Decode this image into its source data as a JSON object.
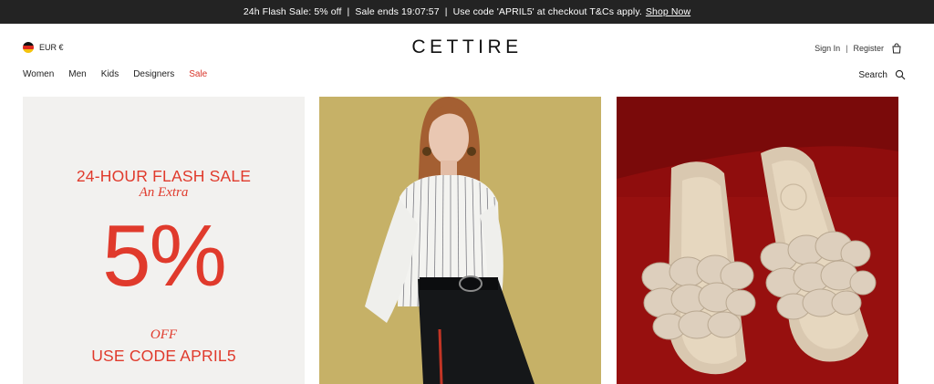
{
  "promo": {
    "text": "24h Flash Sale: 5% off  |  Sale ends 19:07:57  |  Use code 'APRIL5' at checkout T&Cs apply.",
    "link": "Shop Now"
  },
  "header": {
    "currency": "EUR €",
    "flag_colors": [
      "#111111",
      "#dd2a1f",
      "#f4c20d"
    ],
    "logo": "CETTIRE",
    "sign_in": "Sign In",
    "separator": "|",
    "register": "Register",
    "search_label": "Search"
  },
  "nav": {
    "items": [
      {
        "label": "Women"
      },
      {
        "label": "Men"
      },
      {
        "label": "Kids"
      },
      {
        "label": "Designers"
      },
      {
        "label": "Sale",
        "accent": "#d8352a"
      }
    ]
  },
  "tiles": {
    "flash": {
      "title": "24-HOUR FLASH SALE",
      "subtitle": "An Extra",
      "percent": "5%",
      "off": "OFF",
      "code": "USE CODE APRIL5",
      "accent_color": "#e03a2c",
      "background": "#f2f1ef"
    },
    "women": {
      "image": "model-photo",
      "background": "#c9b66e"
    },
    "shoes": {
      "image": "sandals-photo",
      "background": "#8f0d0d"
    }
  }
}
